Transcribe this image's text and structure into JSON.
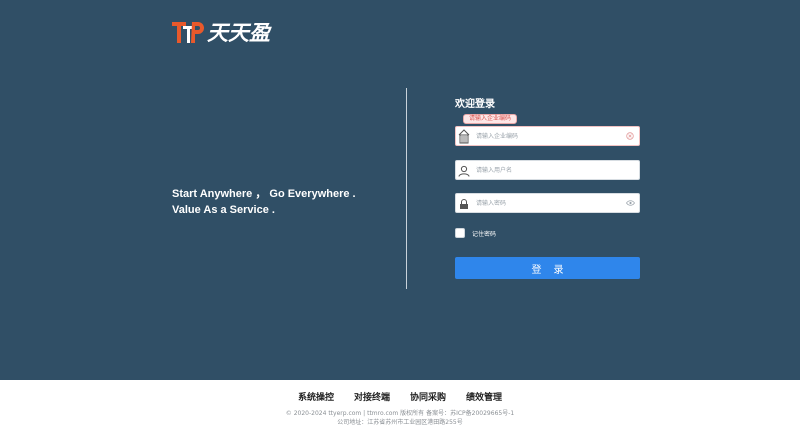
{
  "brand": {
    "name": "天天盈",
    "logo_letters": "TP",
    "colors": {
      "accent": "#e8592b",
      "hero_bg": "#304f66",
      "button": "#2f86eb"
    }
  },
  "hero": {
    "slogan_line1": "Start Anywhere ，  Go Everywhere .",
    "slogan_line2": "Value As a Service ."
  },
  "login": {
    "title": "欢迎登录",
    "company_error": "请输入企业编码",
    "company": {
      "placeholder": "请输入企业编码",
      "icon": "building-icon",
      "suffix_icon": "clear-icon"
    },
    "username": {
      "placeholder": "请输入用户名",
      "icon": "user-icon"
    },
    "password": {
      "placeholder": "请输入密码",
      "icon": "lock-icon",
      "suffix_icon": "eye-icon"
    },
    "remember_label": "记住密码",
    "submit_label": "登录"
  },
  "footer": {
    "nav": [
      "系统操控",
      "对接终端",
      "协同采购",
      "绩效管理"
    ],
    "copyright": "© 2020-2024 ttyerp.com | ttmro.com 版权所有 备案号：苏ICP备20029665号-1",
    "address": "公司地址：江苏省苏州市工业园区港田路255号"
  }
}
